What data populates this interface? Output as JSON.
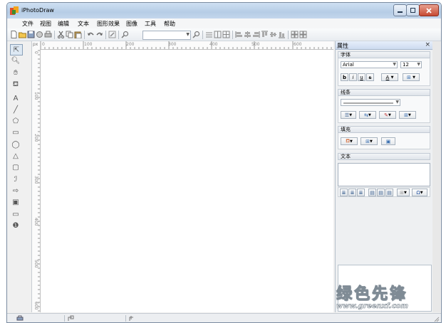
{
  "window": {
    "title": "iPhotoDraw"
  },
  "menu": [
    "文件",
    "视图",
    "编辑",
    "文本",
    "图形效果",
    "图像",
    "工具",
    "帮助"
  ],
  "ruler": {
    "unit": "px",
    "h_ticks": [
      "0",
      "100",
      "200",
      "300",
      "400",
      "500",
      "600"
    ],
    "v_ticks": [
      "0",
      "100",
      "200",
      "300",
      "400",
      "500",
      "600"
    ]
  },
  "panel": {
    "title": "属性",
    "close": "×",
    "font": {
      "label": "字体",
      "family": "Arial",
      "size": "12",
      "bold": "b",
      "italic": "i",
      "underline": "u",
      "strike": "s",
      "color": "A"
    },
    "line": {
      "label": "线条"
    },
    "fill": {
      "label": "填充"
    },
    "text": {
      "label": "文本",
      "special_char": "Ω"
    }
  },
  "watermark": {
    "brand": "绿色先锋",
    "url": "www.greenxf.com"
  }
}
